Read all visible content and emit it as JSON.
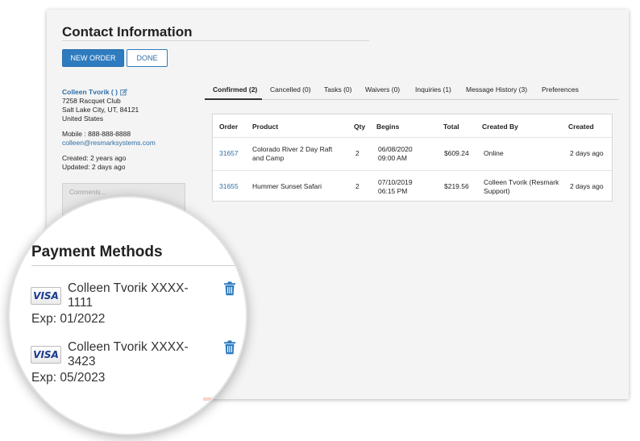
{
  "page": {
    "title": "Contact Information"
  },
  "actions": {
    "new_order": "NEW ORDER",
    "done": "DONE"
  },
  "contact": {
    "name": "Colleen Tvorik ( )",
    "address_line1": "7258 Racquet Club",
    "address_line2": "Salt Lake City, UT, 84121",
    "country": "United States",
    "mobile": "Mobile : 888-888-8888",
    "email": "colleen@resmarksystems.com",
    "created": "Created: 2 years ago",
    "updated": "Updated: 2 days ago",
    "comments_placeholder": "Comments..."
  },
  "tabs": [
    {
      "label": "Confirmed (2)",
      "active": true
    },
    {
      "label": "Cancelled (0)"
    },
    {
      "label": "Tasks (0)"
    },
    {
      "label": "Waivers (0)"
    },
    {
      "label": "Inquiries (1)"
    },
    {
      "label": "Message History (3)"
    },
    {
      "label": "Preferences"
    }
  ],
  "orders": {
    "columns": [
      "Order",
      "Product",
      "Qty",
      "Begins",
      "Total",
      "Created By",
      "Created"
    ],
    "rows": [
      {
        "order": "31657",
        "product": "Colorado River 2 Day Raft and Camp",
        "qty": "2",
        "begins_date": "06/08/2020",
        "begins_time": "09:00 AM",
        "total": "$609.24",
        "created_by": "Online",
        "created": "2 days ago"
      },
      {
        "order": "31655",
        "product": "Hummer Sunset Safari",
        "qty": "2",
        "begins_date": "07/10/2019",
        "begins_time": "06:15 PM",
        "total": "$219.56",
        "created_by": "Colleen Tvorik (Resmark Support)",
        "created": "2 days ago"
      }
    ]
  },
  "payment_methods": {
    "title": "Payment Methods",
    "cards": [
      {
        "brand": "VISA",
        "holder_number": "Colleen Tvorik  XXXX-\n1111",
        "exp": "Exp: 01/2022"
      },
      {
        "brand": "VISA",
        "holder_number": "Colleen Tvorik  XXXX-\n3423",
        "exp": "Exp: 05/2023"
      }
    ]
  },
  "colors": {
    "accent": "#2e7bbf",
    "link": "#2e6ea6",
    "panel_bg": "#f4f4f4",
    "visa_text": "#1a3b8f"
  },
  "icons": {
    "edit": "edit-icon",
    "trash": "trash-icon",
    "card_brand": "visa-icon"
  }
}
